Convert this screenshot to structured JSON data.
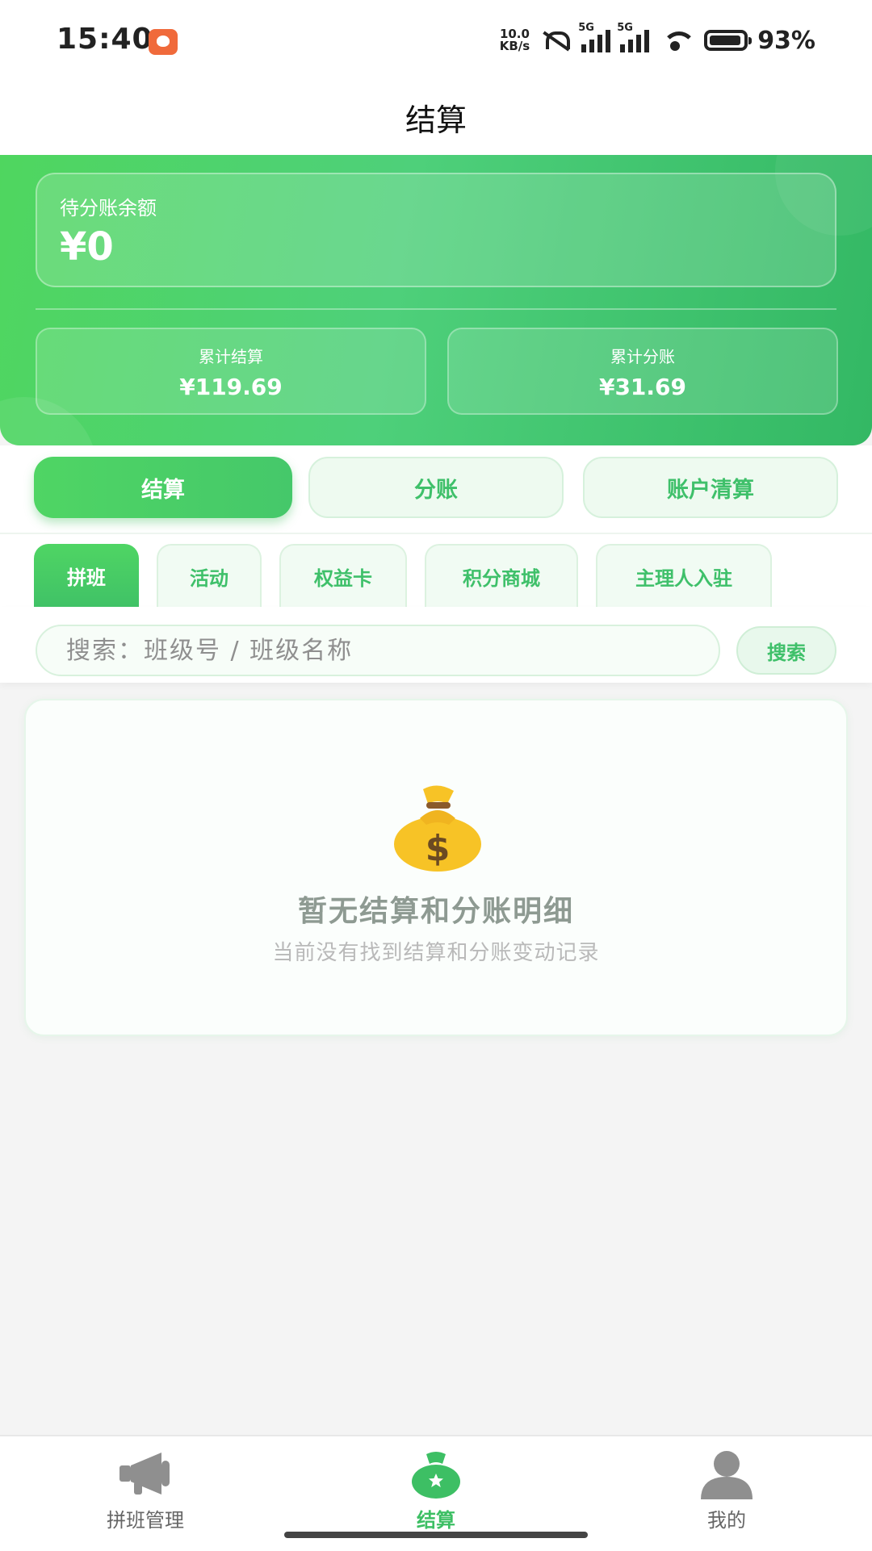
{
  "status_bar": {
    "time": "15:40",
    "net_speed_value": "10.0",
    "net_speed_unit": "KB/s",
    "sig1_label": "5G",
    "sig2_label": "5G",
    "battery_pct": "93%"
  },
  "nav": {
    "title": "结算"
  },
  "summary": {
    "pending_label": "待分账余额",
    "pending_value": "¥0",
    "settled_label": "累计结算",
    "settled_value": "¥119.69",
    "split_label": "累计分账",
    "split_value": "¥31.69"
  },
  "main_tabs": [
    {
      "label": "结算",
      "active": true
    },
    {
      "label": "分账",
      "active": false
    },
    {
      "label": "账户清算",
      "active": false
    }
  ],
  "sub_tabs": [
    {
      "label": "拼班",
      "active": true
    },
    {
      "label": "活动",
      "active": false
    },
    {
      "label": "权益卡",
      "active": false
    },
    {
      "label": "积分商城",
      "active": false
    },
    {
      "label": "主理人入驻",
      "active": false
    }
  ],
  "search": {
    "placeholder": "搜索：班级号 / 班级名称",
    "button_label": "搜索"
  },
  "empty_state": {
    "icon": "money-bag-icon",
    "title": "暂无结算和分账明细",
    "subtitle": "当前没有找到结算和分账变动记录"
  },
  "bottom_nav": [
    {
      "label": "拼班管理",
      "icon": "megaphone-icon",
      "active": false
    },
    {
      "label": "结算",
      "icon": "money-bag-icon",
      "active": true
    },
    {
      "label": "我的",
      "icon": "user-icon",
      "active": false
    }
  ],
  "colors": {
    "brand_green": "#4fd564",
    "accent_text_green": "#3fc06a",
    "background": "#f4f4f4"
  }
}
